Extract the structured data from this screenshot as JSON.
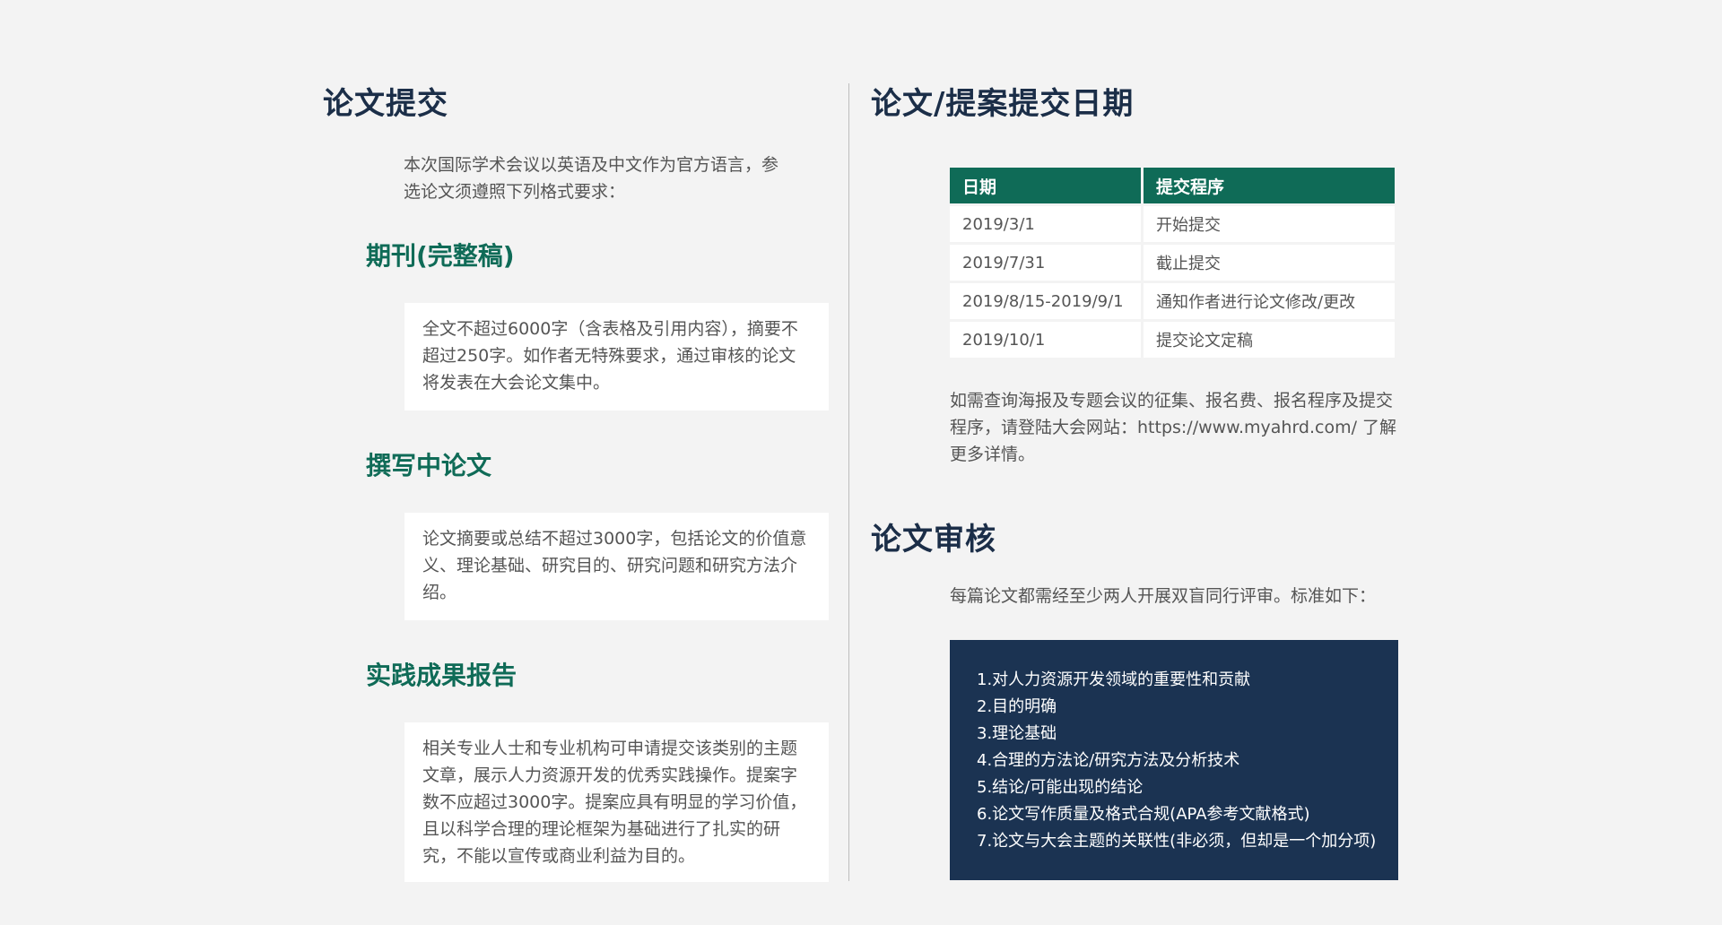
{
  "left": {
    "title": "论文提交",
    "intro": "本次国际学术会议以英语及中文作为官方语言，参选论文须遵照下列格式要求：",
    "sections": [
      {
        "heading": "期刊(完整稿)",
        "body": "全文不超过6000字（含表格及引用内容），摘要不超过250字。如作者无特殊要求，通过审核的论文将发表在大会论文集中。"
      },
      {
        "heading": "撰写中论文",
        "body": "论文摘要或总结不超过3000字，包括论文的价值意义、理论基础、研究目的、研究问题和研究方法介绍。"
      },
      {
        "heading": "实践成果报告",
        "body": "相关专业人士和专业机构可申请提交该类别的主题文章，展示人力资源开发的优秀实践操作。提案字数不应超过3000字。提案应具有明显的学习价值，且以科学合理的理论框架为基础进行了扎实的研究，不能以宣传或商业利益为目的。"
      }
    ]
  },
  "right": {
    "dates_title": "论文/提案提交日期",
    "table": {
      "headers": [
        "日期",
        "提交程序"
      ],
      "rows": [
        [
          "2019/3/1",
          "开始提交"
        ],
        [
          "2019/7/31",
          "截止提交"
        ],
        [
          "2019/8/15-2019/9/1",
          "通知作者进行论文修改/更改"
        ],
        [
          "2019/10/1",
          "提交论文定稿"
        ]
      ]
    },
    "note": "如需查询海报及专题会议的征集、报名费、报名程序及提交程序，请登陆大会网站：https://www.myahrd.com/ 了解更多详情。",
    "review_title": "论文审核",
    "review_intro": "每篇论文都需经至少两人开展双盲同行评审。标准如下：",
    "criteria": [
      "1.对人力资源开发领域的重要性和贡献",
      "2.目的明确",
      "3.理论基础",
      "4.合理的方法论/研究方法及分析技术",
      "5.结论/可能出现的结论",
      "6.论文写作质量及格式合规(APA参考文献格式)",
      "7.论文与大会主题的关联性(非必须，但却是一个加分项)"
    ]
  },
  "colors": {
    "navy": "#1b2e48",
    "green": "#0f6b57",
    "panel_navy": "#1b3352",
    "background": "#f3f3f3"
  }
}
